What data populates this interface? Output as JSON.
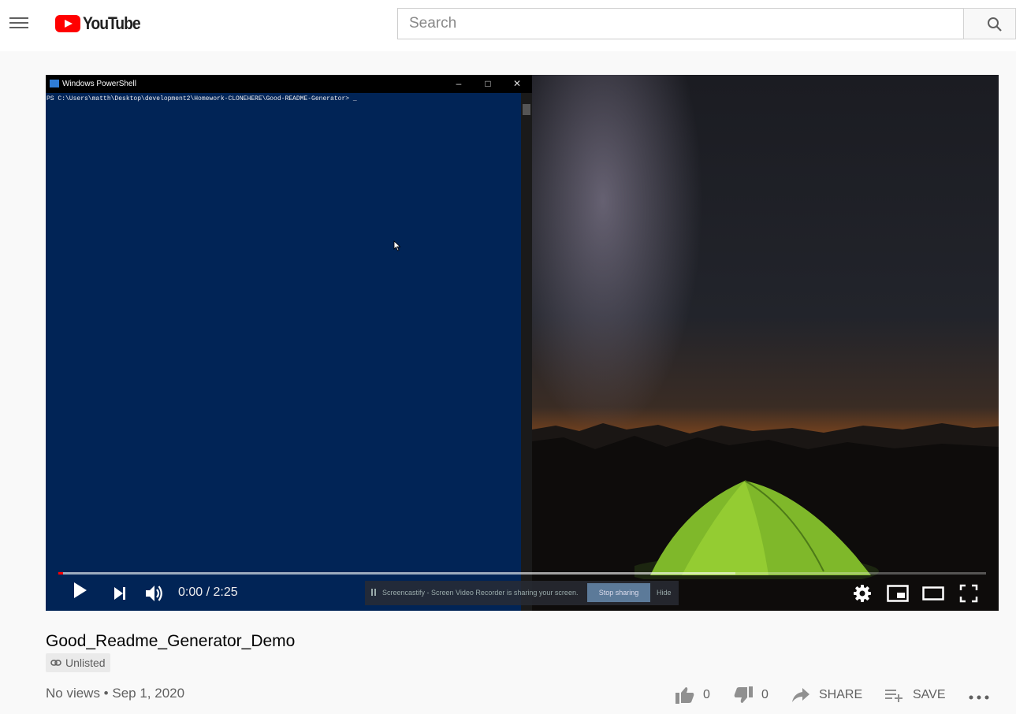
{
  "masthead": {
    "logo_text": "YouTube",
    "search_placeholder": "Search",
    "icons": [
      "menu-icon",
      "youtube-logo",
      "search-icon"
    ]
  },
  "player": {
    "powershell": {
      "window_title": "Windows PowerShell",
      "prompt": "PS C:\\Users\\matth\\Desktop\\development2\\Homework-CLONEHERE\\Good-README-Generator> _"
    },
    "time": "0:00 / 2:25",
    "progress_played": 0.005,
    "progress_loaded": 0.73,
    "screencastify": {
      "message": "Screencastify - Screen Video Recorder is sharing your screen.",
      "stop_label": "Stop sharing",
      "hide_label": "Hide"
    },
    "icons": [
      "play-icon",
      "next-icon",
      "volume-icon",
      "settings-icon",
      "miniplayer-icon",
      "theater-icon",
      "fullscreen-icon"
    ]
  },
  "video": {
    "title": "Good_Readme_Generator_Demo",
    "visibility": "Unlisted",
    "meta": "No views • Sep 1, 2020"
  },
  "actions": {
    "like_count": "0",
    "dislike_count": "0",
    "share_label": "SHARE",
    "save_label": "SAVE"
  },
  "colors": {
    "brand_red": "#ff0000",
    "powershell_bg": "#012456",
    "page_bg": "#f9f9f9"
  }
}
